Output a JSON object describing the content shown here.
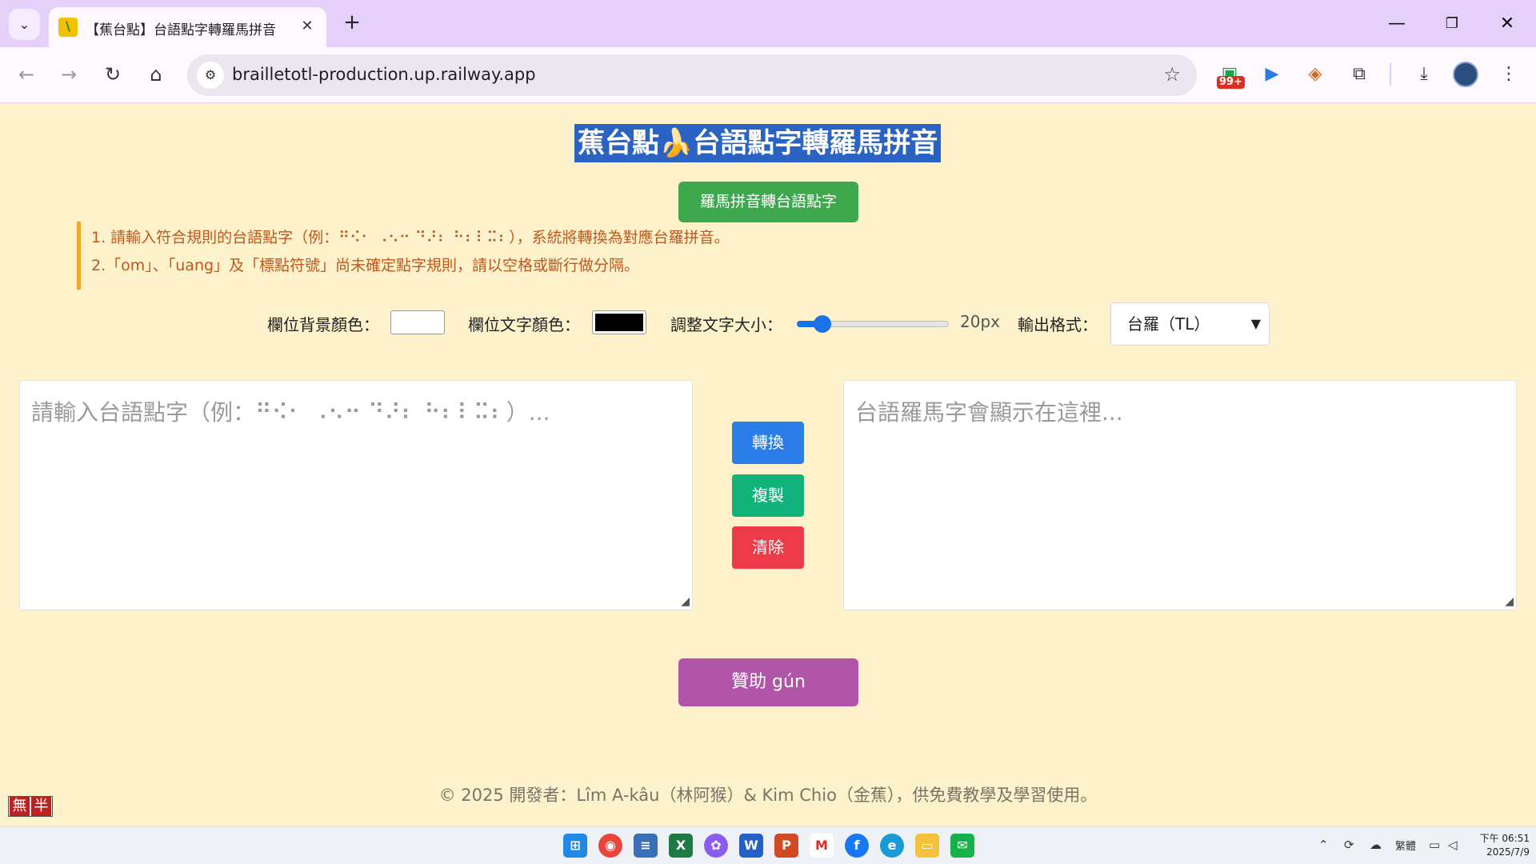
{
  "browser": {
    "tab_title": "【蕉台點】台語點字轉羅馬拼音",
    "url": "brailletotl-production.up.railway.app",
    "extension_badge": "99+"
  },
  "page": {
    "title": "蕉台點🍌台語點字轉羅馬拼音",
    "reverse_button": "羅馬拼音轉台語點字",
    "notes": [
      "1. 請輸入符合規則的台語點字（例：⠛⠪⠂ ⠠⠢⠒ ⠙⠜⠆ ⠓⠆⠇⠭⠆），系統將轉換為對應台羅拼音。",
      "2.「om」、「uang」及「標點符號」尚未確定點字規則，請以空格或斷行做分隔。"
    ],
    "controls": {
      "bg_color_label": "欄位背景顏色：",
      "bg_color_value": "#ffffff",
      "text_color_label": "欄位文字顏色：",
      "text_color_value": "#000000",
      "font_size_label": "調整文字大小：",
      "font_size_value": "20px",
      "font_size_fraction": 0.17,
      "format_label": "輸出格式：",
      "format_selected": "台羅（TL）"
    },
    "input_placeholder": "請輸入台語點字（例：⠛⠪⠂ ⠠⠢⠒ ⠙⠜⠆ ⠓⠆⠇⠭⠆）...",
    "output_placeholder": "台語羅馬字會顯示在這裡...",
    "buttons": {
      "convert": "轉換",
      "copy": "複製",
      "clear": "清除",
      "sponsor": "贊助 gún"
    },
    "footer": "© 2025 開發者：Lîm A-kâu（林阿猴）& Kim Chio（金蕉），供免費教學及學習使用。",
    "ime_indicator": [
      "無",
      "半"
    ]
  },
  "colors": {
    "page_bg": "#fef2cc",
    "title_highlight": "#2a63c4",
    "green_button": "#3ea84e",
    "convert_button": "#2b7de9",
    "copy_button": "#12b37a",
    "clear_button": "#ee3b4a",
    "sponsor_button": "#b055a7",
    "note_text": "#c0571b",
    "note_border": "#f5a524"
  },
  "taskbar": {
    "tray_language": "繁體",
    "time": "下午 06:51",
    "date": "2025/7/9"
  }
}
